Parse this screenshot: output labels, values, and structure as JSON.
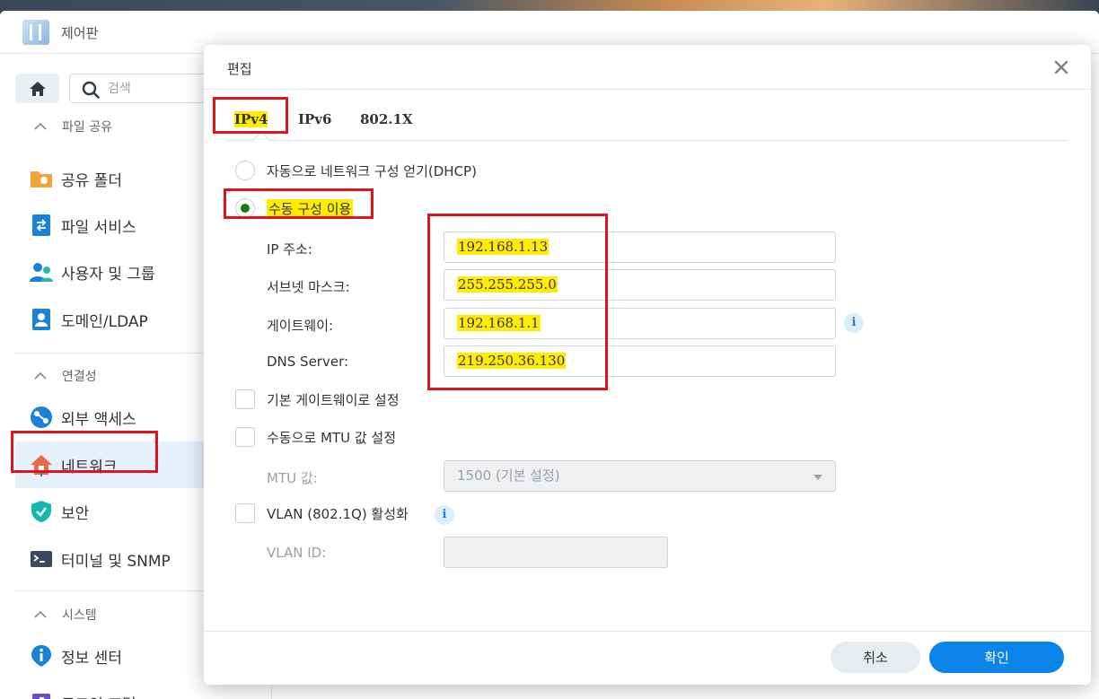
{
  "app": {
    "title": "제어판"
  },
  "sidebar": {
    "search_placeholder": "검색",
    "sections": [
      {
        "label": "파일 공유",
        "items": [
          "공유 폴더",
          "파일 서비스",
          "사용자 및 그룹",
          "도메인/LDAP"
        ]
      },
      {
        "label": "연결성",
        "items": [
          "외부 액세스",
          "네트워크",
          "보안",
          "터미널 및 SNMP"
        ]
      },
      {
        "label": "시스템",
        "items": [
          "정보 센터",
          "로그인 포털"
        ]
      }
    ],
    "selected_item": "네트워크"
  },
  "dialog": {
    "title": "편집",
    "tabs": [
      "IPv4",
      "IPv6",
      "802.1X"
    ],
    "active_tab": "IPv4",
    "radio_dhcp": "자동으로 네트워크 구성 얻기(DHCP)",
    "radio_manual": "수동 구성 이용",
    "fields": {
      "ip_label": "IP 주소:",
      "ip_value": "192.168.1.13",
      "subnet_label": "서브넷 마스크:",
      "subnet_value": "255.255.255.0",
      "gateway_label": "게이트웨이:",
      "gateway_value": "192.168.1.1",
      "dns_label": "DNS Server:",
      "dns_value": "219.250.36.130"
    },
    "checkbox_default_gateway": "기본 게이트웨이로 설정",
    "checkbox_manual_mtu": "수동으로 MTU 값 설정",
    "mtu_label": "MTU 값:",
    "mtu_value": "1500 (기본 설정)",
    "checkbox_vlan": "VLAN (802.1Q) 활성화",
    "vlan_id_label": "VLAN ID:",
    "vlan_id_value": "",
    "cancel_label": "취소",
    "ok_label": "확인"
  },
  "colors": {
    "accent": "#0a84e8",
    "annotation_red": "#e0141e",
    "highlight_yellow": "#ffec00",
    "selected_bg": "#e6f1fb"
  }
}
